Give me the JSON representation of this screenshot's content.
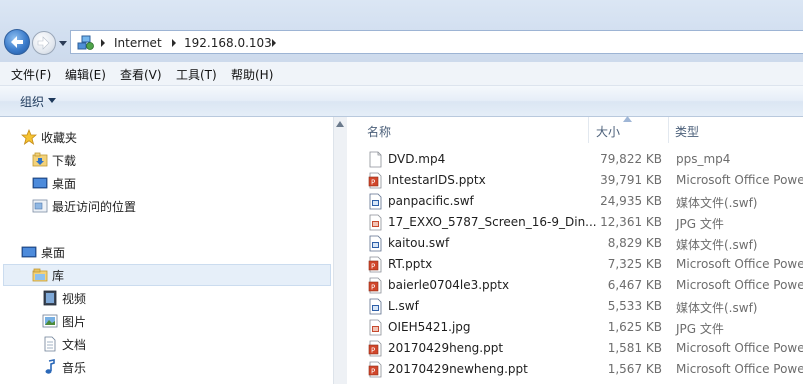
{
  "address_bar": {
    "crumbs": [
      "Internet",
      "192.168.0.103"
    ],
    "icon": "network-globe-icon"
  },
  "menu": [
    "文件(F)",
    "编辑(E)",
    "查看(V)",
    "工具(T)",
    "帮助(H)"
  ],
  "toolbar": {
    "organize_label": "组织"
  },
  "nav": {
    "favorites": {
      "label": "收藏夹",
      "icon": "star-icon"
    },
    "favorite_items": [
      {
        "label": "下载",
        "icon": "download-folder-icon"
      },
      {
        "label": "桌面",
        "icon": "desktop-icon"
      },
      {
        "label": "最近访问的位置",
        "icon": "recent-places-icon"
      }
    ],
    "desktop": {
      "label": "桌面",
      "icon": "desktop-icon"
    },
    "library": {
      "label": "库",
      "icon": "library-folder-icon"
    },
    "library_items": [
      {
        "label": "视频",
        "icon": "video-icon"
      },
      {
        "label": "图片",
        "icon": "picture-icon"
      },
      {
        "label": "文档",
        "icon": "document-icon"
      },
      {
        "label": "音乐",
        "icon": "music-icon"
      }
    ]
  },
  "columns": {
    "name": "名称",
    "size": "大小",
    "type": "类型"
  },
  "files": [
    {
      "name": "DVD.mp4",
      "size": "79,822 KB",
      "type": "pps_mp4",
      "icon": "blank-file-icon"
    },
    {
      "name": "IntestarIDS.pptx",
      "size": "39,791 KB",
      "type": "Microsoft Office Powe",
      "icon": "powerpoint-icon"
    },
    {
      "name": "panpacific.swf",
      "size": "24,935 KB",
      "type": "媒体文件(.swf)",
      "icon": "media-file-icon"
    },
    {
      "name": "17_EXXO_5787_Screen_16-9_Din...",
      "size": "12,361 KB",
      "type": "JPG 文件",
      "icon": "image-file-icon"
    },
    {
      "name": "kaitou.swf",
      "size": "8,829 KB",
      "type": "媒体文件(.swf)",
      "icon": "media-file-icon"
    },
    {
      "name": "RT.pptx",
      "size": "7,325 KB",
      "type": "Microsoft Office Powe",
      "icon": "powerpoint-icon"
    },
    {
      "name": "baierle0704le3.pptx",
      "size": "6,467 KB",
      "type": "Microsoft Office Powe",
      "icon": "powerpoint-icon"
    },
    {
      "name": "L.swf",
      "size": "5,533 KB",
      "type": "媒体文件(.swf)",
      "icon": "media-file-icon"
    },
    {
      "name": "OIEH5421.jpg",
      "size": "1,625 KB",
      "type": "JPG 文件",
      "icon": "image-file-icon"
    },
    {
      "name": "20170429heng.ppt",
      "size": "1,581 KB",
      "type": "Microsoft Office Powe",
      "icon": "powerpoint-icon"
    },
    {
      "name": "20170429newheng.ppt",
      "size": "1,567 KB",
      "type": "Microsoft Office Powe",
      "icon": "powerpoint-icon"
    }
  ]
}
